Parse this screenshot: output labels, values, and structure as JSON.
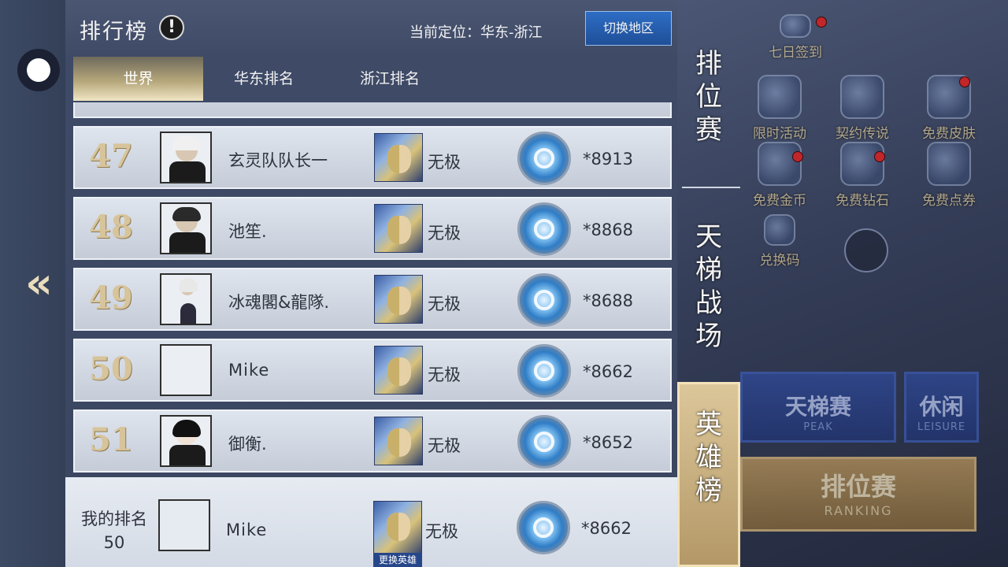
{
  "header": {
    "title": "排行榜",
    "info_icon": "!",
    "location": "当前定位：华东-浙江",
    "switch_button": "切换地区"
  },
  "tabs": [
    {
      "label": "世界",
      "active": true
    },
    {
      "label": "华东排名",
      "active": false
    },
    {
      "label": "浙江排名",
      "active": false
    }
  ],
  "rows": [
    {
      "rank": "47",
      "name": "玄灵队队长一",
      "hero": "无极",
      "score": "*8913",
      "hair": "#f0f0f0"
    },
    {
      "rank": "48",
      "name": "池笙.",
      "hero": "无极",
      "score": "*8868",
      "hair": "#2a2a2a"
    },
    {
      "rank": "49",
      "name": "冰魂閣&龍隊.",
      "hero": "无极",
      "score": "*8688",
      "hair": "#e8e8e8"
    },
    {
      "rank": "50",
      "name": "Mike",
      "hero": "无极",
      "score": "*8662",
      "hair": ""
    },
    {
      "rank": "51",
      "name": "御衡.",
      "hero": "无极",
      "score": "*8652",
      "hair": "#111111"
    }
  ],
  "my_rank": {
    "label": "我的排名",
    "rank": "50",
    "name": "Mike",
    "hero": "无极",
    "change_hero": "更换英雄",
    "score": "*8662"
  },
  "side_tabs": [
    {
      "label": "排\n位\n赛",
      "active": false
    },
    {
      "label": "天\n梯\n战\n场",
      "active": false
    },
    {
      "label": "英\n雄\n榜",
      "active": true
    }
  ],
  "background": {
    "icons": [
      "七日签到",
      "限时活动",
      "契约传说",
      "免费皮肤",
      "免费金币",
      "免费钻石",
      "免费点券",
      "兑换码"
    ],
    "modes": [
      {
        "title": "天梯赛",
        "sub": "PEAK"
      },
      {
        "title": "休闲",
        "sub": "LEISURE"
      }
    ],
    "ranking": {
      "title": "排位赛",
      "sub": "RANKING"
    }
  }
}
